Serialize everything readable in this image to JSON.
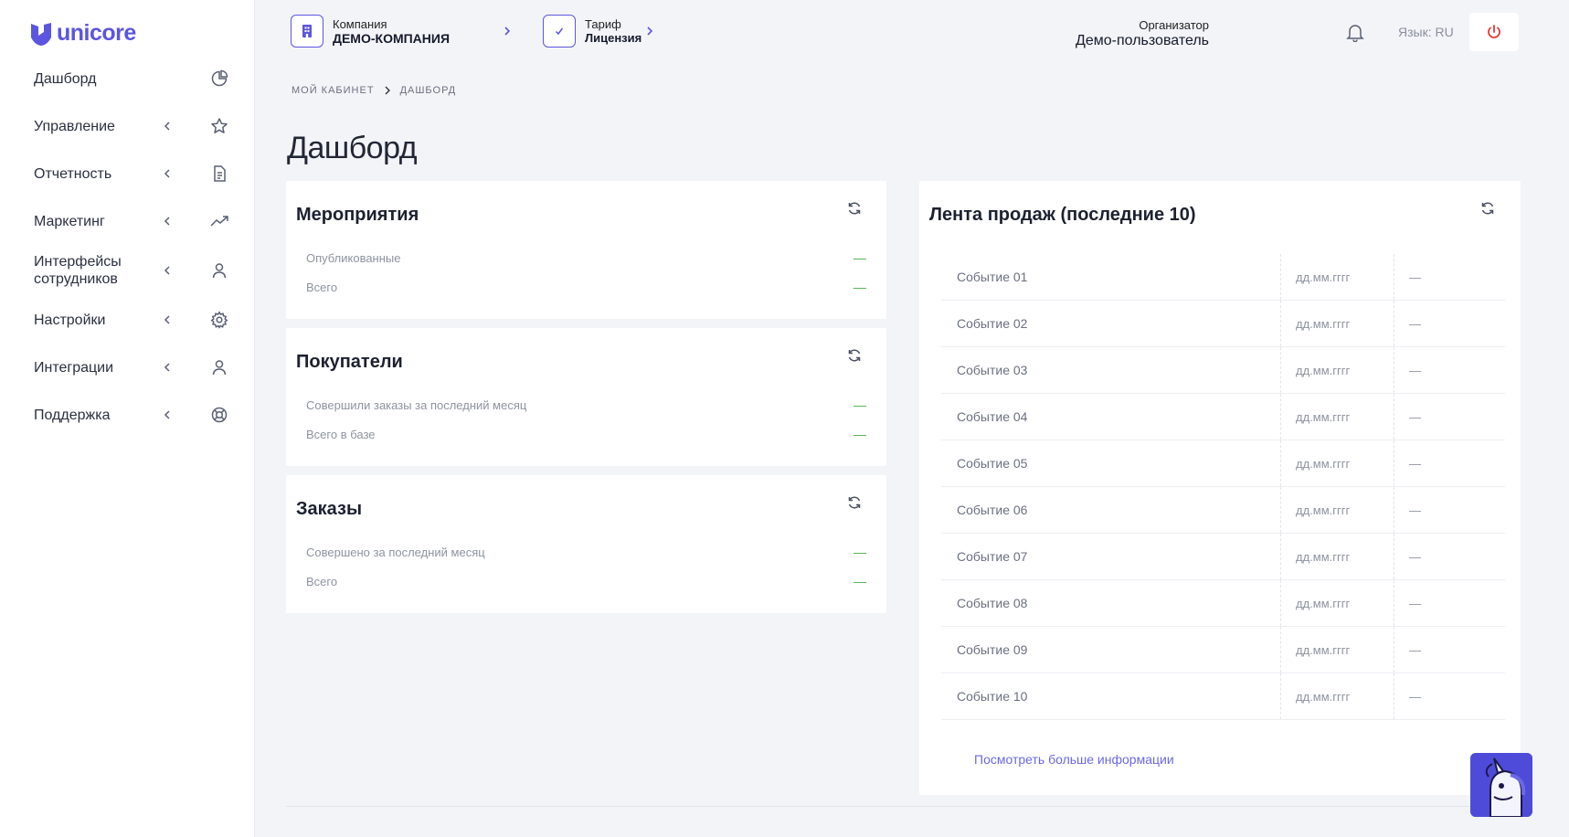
{
  "brand": {
    "name": "unicore",
    "accent": "#5b55e0"
  },
  "sidebar": {
    "items": [
      {
        "label": "Дашборд",
        "icon": "pie-chart-icon",
        "has_chevron": false
      },
      {
        "label": "Управление",
        "icon": "star-icon",
        "has_chevron": true
      },
      {
        "label": "Отчетность",
        "icon": "document-icon",
        "has_chevron": true
      },
      {
        "label": "Маркетинг",
        "icon": "trending-up-icon",
        "has_chevron": true
      },
      {
        "label": "Интерфейсы сотрудников",
        "icon": "user-icon",
        "has_chevron": true
      },
      {
        "label": "Настройки",
        "icon": "gear-icon",
        "has_chevron": true
      },
      {
        "label": "Интеграции",
        "icon": "user-icon",
        "has_chevron": true
      },
      {
        "label": "Поддержка",
        "icon": "lifebuoy-icon",
        "has_chevron": true
      }
    ]
  },
  "topbar": {
    "company_label": "Компания",
    "company_name": "ДЕМО-КОМПАНИЯ",
    "tariff_label": "Тариф",
    "tariff_name": "Лицензия",
    "user_role": "Организатор",
    "user_name": "Демо-пользователь",
    "language": "Язык: RU"
  },
  "breadcrumb": {
    "root": "МОЙ КАБИНЕТ",
    "current": "ДАШБОРД"
  },
  "page_title": "Дашборд",
  "cards": {
    "events": {
      "title": "Мероприятия",
      "rows": [
        {
          "label": "Опубликованные",
          "value": "—"
        },
        {
          "label": "Всего",
          "value": "—"
        }
      ]
    },
    "buyers": {
      "title": "Покупатели",
      "rows": [
        {
          "label": "Совершили заказы за последний месяц",
          "value": "—"
        },
        {
          "label": "Всего в базе",
          "value": "—"
        }
      ]
    },
    "orders": {
      "title": "Заказы",
      "rows": [
        {
          "label": "Совершено за последний месяц",
          "value": "—"
        },
        {
          "label": "Всего",
          "value": "—"
        }
      ]
    }
  },
  "sales": {
    "title": "Лента продаж (последние 10)",
    "rows": [
      {
        "name": "Событие 01",
        "date": "дд.мм.гггг",
        "value": "—"
      },
      {
        "name": "Событие 02",
        "date": "дд.мм.гггг",
        "value": "—"
      },
      {
        "name": "Событие 03",
        "date": "дд.мм.гггг",
        "value": "—"
      },
      {
        "name": "Событие 04",
        "date": "дд.мм.гггг",
        "value": "—"
      },
      {
        "name": "Событие 05",
        "date": "дд.мм.гггг",
        "value": "—"
      },
      {
        "name": "Событие 06",
        "date": "дд.мм.гггг",
        "value": "—"
      },
      {
        "name": "Событие 07",
        "date": "дд.мм.гггг",
        "value": "—"
      },
      {
        "name": "Событие 08",
        "date": "дд.мм.гггг",
        "value": "—"
      },
      {
        "name": "Событие 09",
        "date": "дд.мм.гггг",
        "value": "—"
      },
      {
        "name": "Событие 10",
        "date": "дд.мм.гггг",
        "value": "—"
      }
    ],
    "more_link": "Посмотреть больше информации"
  },
  "colors": {
    "positive": "#4caf50",
    "danger": "#e53935",
    "link": "#6d68e6"
  }
}
